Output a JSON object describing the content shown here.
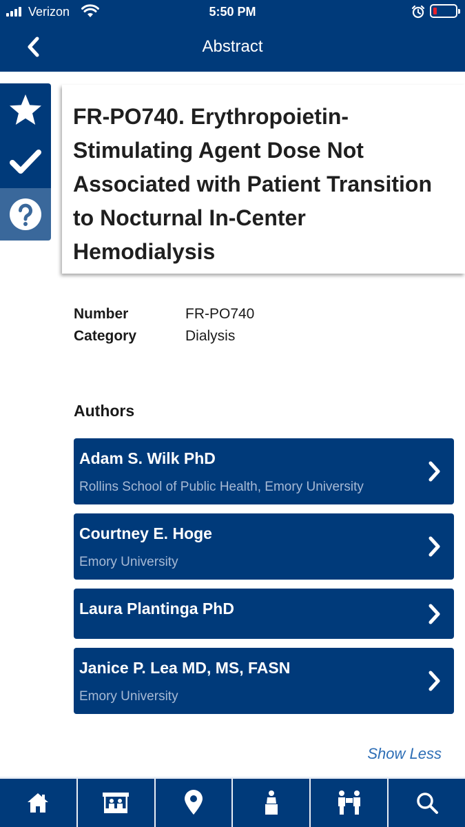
{
  "status_bar": {
    "carrier": "Verizon",
    "time": "5:50 PM"
  },
  "header": {
    "title": "Abstract",
    "back_icon": "chevron-left-icon"
  },
  "side_actions": [
    {
      "name": "favorite",
      "icon": "star-icon"
    },
    {
      "name": "mark-attended",
      "icon": "checkmark-icon"
    },
    {
      "name": "help",
      "icon": "question-icon"
    }
  ],
  "abstract": {
    "title": "FR-PO740. Erythropoietin-Stimulating Agent Dose Not Associated with Patient Transition to Nocturnal In-Center Hemodialysis",
    "number_label": "Number",
    "number_value": "FR-PO740",
    "category_label": "Category",
    "category_value": "Dialysis"
  },
  "authors": {
    "heading": "Authors",
    "items": [
      {
        "name": "Adam S. Wilk PhD",
        "affiliation": "Rollins School of Public Health, Emory University"
      },
      {
        "name": "Courtney E. Hoge",
        "affiliation": "Emory University"
      },
      {
        "name": "Laura Plantinga PhD",
        "affiliation": ""
      },
      {
        "name": "Janice P. Lea MD, MS, FASN",
        "affiliation": "Emory University"
      }
    ],
    "show_less": "Show Less"
  },
  "tab_bar": [
    {
      "name": "home",
      "icon": "home-icon"
    },
    {
      "name": "exhibitors",
      "icon": "booth-icon"
    },
    {
      "name": "map",
      "icon": "map-pin-icon"
    },
    {
      "name": "speakers",
      "icon": "speaker-icon"
    },
    {
      "name": "networking",
      "icon": "people-icon"
    },
    {
      "name": "search",
      "icon": "search-icon"
    }
  ],
  "colors": {
    "primary": "#003a7a",
    "secondary": "#3a689b",
    "link": "#2c6db5",
    "affiliation_text": "#a7bad5",
    "battery_low": "#e8202a"
  }
}
